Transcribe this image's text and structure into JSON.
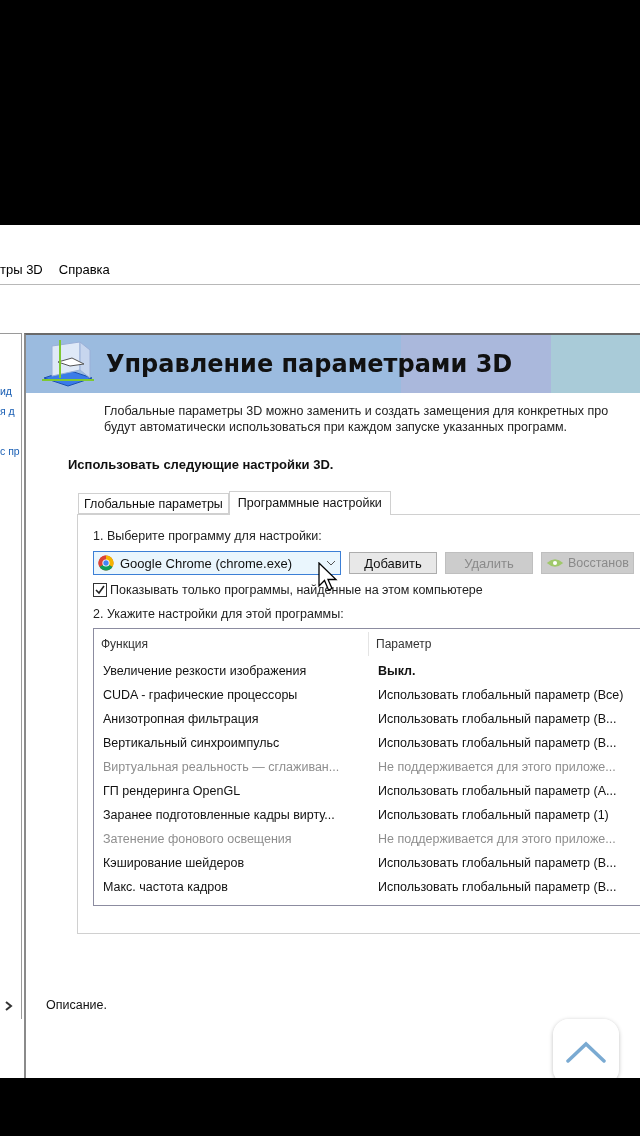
{
  "menu": [
    {
      "label": "тры 3D"
    },
    {
      "label": "Справка"
    }
  ],
  "sidebar": {
    "links": [
      "ид",
      "я д",
      "с пр"
    ]
  },
  "header": {
    "title": "Управление параметрами 3D"
  },
  "intro": [
    "Глобальные параметры 3D можно заменить и создать замещения для конкретных про",
    "будут автоматически использоваться при каждом запуске указанных программ."
  ],
  "section_title": "Использовать следующие настройки 3D.",
  "tabs": [
    {
      "label": "Глобальные параметры",
      "selected": false
    },
    {
      "label": "Программные настройки",
      "selected": true
    }
  ],
  "step1": {
    "label": "1. Выберите программу для настройки:",
    "program": {
      "value": "Google Chrome (chrome.exe)"
    },
    "buttons": [
      {
        "label": "Добавить",
        "disabled": false,
        "kind": "plain"
      },
      {
        "label": "Удалить",
        "disabled": true,
        "kind": "plain"
      },
      {
        "label": "Восстанов",
        "disabled": true,
        "kind": "restore"
      }
    ]
  },
  "show_only_found": {
    "label": "Показывать только программы, найденные на этом компьютере",
    "checked": true
  },
  "step2": {
    "label": "2. Укажите настройки для этой программы:"
  },
  "table": {
    "columns": [
      "Функция",
      "Параметр"
    ],
    "rows": [
      {
        "function": "Увеличение резкости изображения",
        "value": "Выкл.",
        "disabled": false,
        "modified": true
      },
      {
        "function": "CUDA - графические процессоры",
        "value": "Использовать глобальный параметр (Все)",
        "disabled": false,
        "modified": false
      },
      {
        "function": "Анизотропная фильтрация",
        "value": "Использовать глобальный параметр (В...",
        "disabled": false,
        "modified": false
      },
      {
        "function": "Вертикальный синхроимпульс",
        "value": "Использовать глобальный параметр (В...",
        "disabled": false,
        "modified": false
      },
      {
        "function": "Виртуальная реальность — сглаживан...",
        "value": "Не поддерживается для этого приложе...",
        "disabled": true,
        "modified": false
      },
      {
        "function": "ГП рендеринга OpenGL",
        "value": "Использовать глобальный параметр (А...",
        "disabled": false,
        "modified": false
      },
      {
        "function": "Заранее подготовленные кадры вирту...",
        "value": "Использовать глобальный параметр (1)",
        "disabled": false,
        "modified": false
      },
      {
        "function": "Затенение фонового освещения",
        "value": "Не поддерживается для этого приложе...",
        "disabled": true,
        "modified": false
      },
      {
        "function": "Кэширование шейдеров",
        "value": "Использовать глобальный параметр (В...",
        "disabled": false,
        "modified": false
      },
      {
        "function": "Макс. частота кадров",
        "value": "Использовать глобальный параметр (В...",
        "disabled": false,
        "modified": false
      }
    ]
  },
  "description": "Описание."
}
